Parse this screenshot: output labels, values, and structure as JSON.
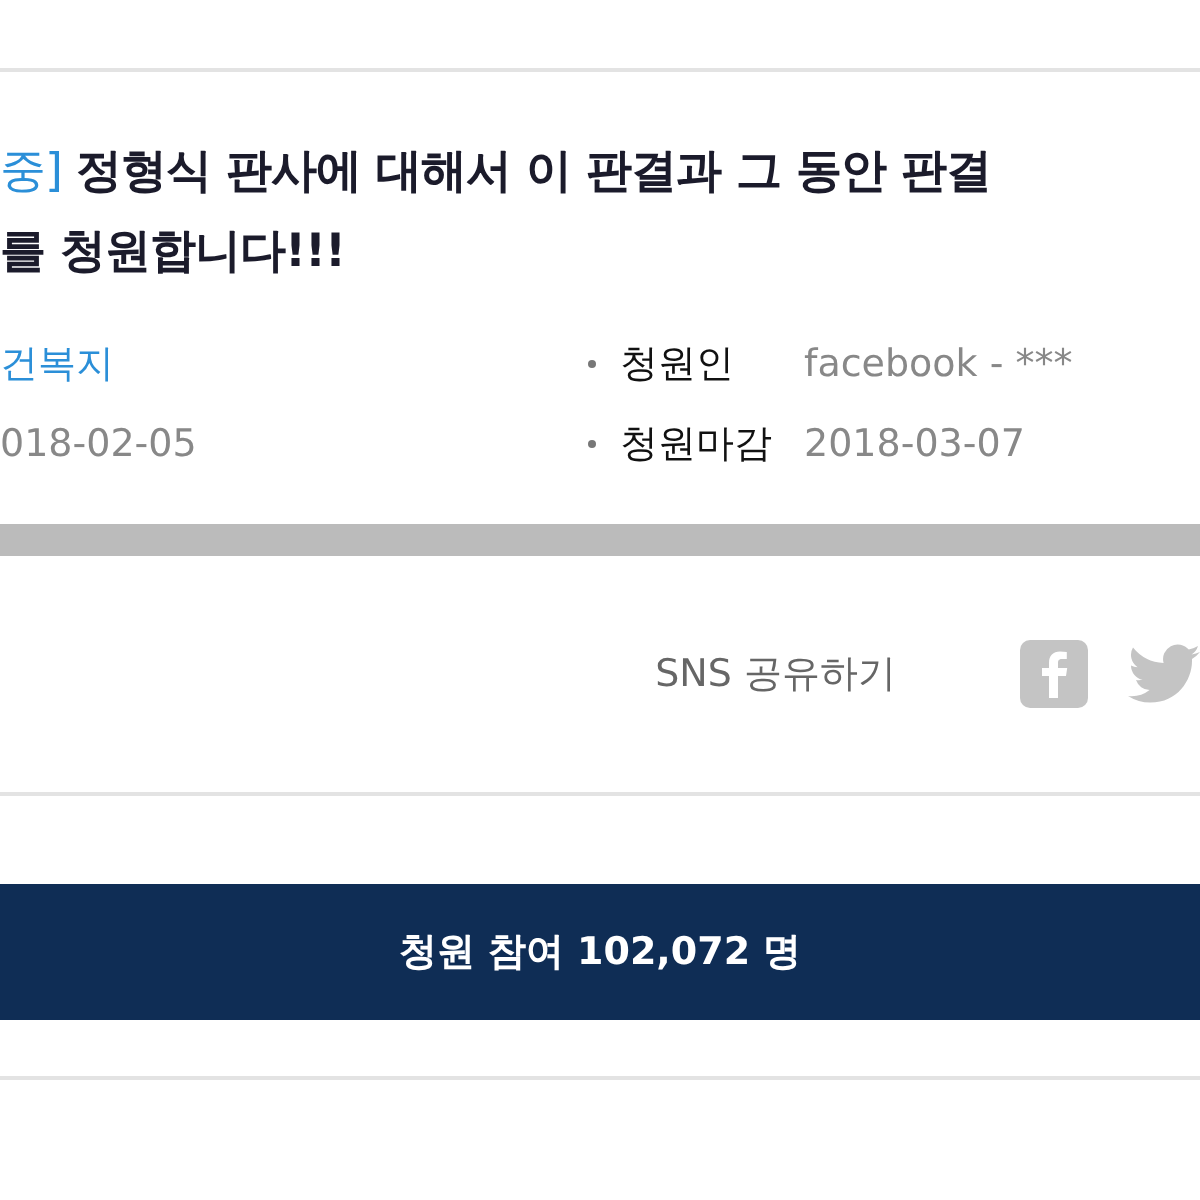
{
  "petition": {
    "status": "중]",
    "title_lines": [
      "정형식 판사에 대해서 이 판결과 그 동안 판결",
      "를 청원합니다!!!"
    ],
    "meta_left": [
      {
        "kind": "link",
        "value": "건복지"
      },
      {
        "kind": "plain",
        "value": "018-02-05"
      }
    ],
    "meta_right": [
      {
        "label": "청원인",
        "value": "facebook - ***"
      },
      {
        "label": "청원마감",
        "value": "2018-03-07"
      }
    ]
  },
  "share": {
    "label": "SNS 공유하기"
  },
  "join_button": "청원 참여 102,072 명"
}
